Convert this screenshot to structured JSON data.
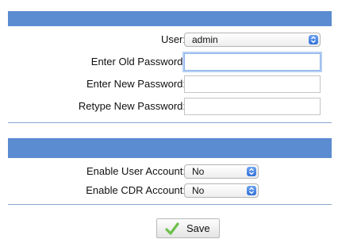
{
  "colors": {
    "section_header": "#5b8bd0",
    "select_arrow": "#2f6fd8",
    "check_icon": "#6cc04a"
  },
  "password_section": {
    "user_label": "User:",
    "user_value": "admin",
    "old_password_label": "Enter Old Password:",
    "old_password_value": "",
    "new_password_label": "Enter New Password:",
    "new_password_value": "",
    "retype_password_label": "Retype New Password:",
    "retype_password_value": ""
  },
  "account_section": {
    "user_account_label": "Enable User Account:",
    "user_account_value": "No",
    "cdr_account_label": "Enable CDR Account:",
    "cdr_account_value": "No"
  },
  "actions": {
    "save_label": "Save",
    "save_icon": "checkmark-icon"
  }
}
